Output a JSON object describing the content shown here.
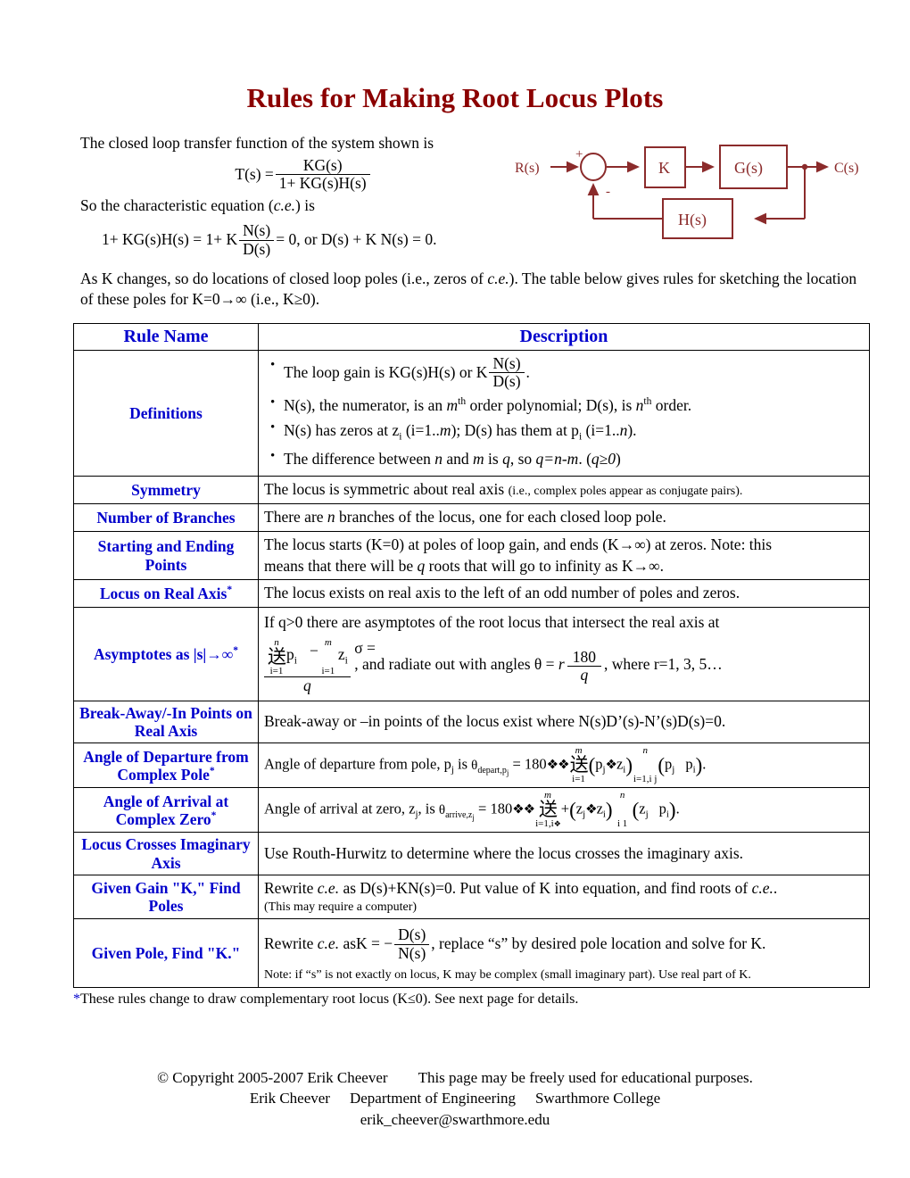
{
  "document": {
    "title": "Rules for Making Root Locus Plots",
    "title_color": "#8B0000",
    "accent_color": "#0000CC"
  },
  "intro": {
    "line1": "The closed loop transfer function of the system shown is",
    "transfer_function": {
      "lhs": "T(s) =",
      "numerator": "KG(s)",
      "denominator": "1+ KG(s)H(s)"
    },
    "line2_a": "So the characteristic equation (",
    "line2_ce": "c.e.",
    "line2_b": ") is",
    "char_eq": {
      "lhs": "1+ KG(s)H(s) = 1+ K",
      "numerator": "N(s)",
      "denominator": "D(s)",
      "mid": "= 0",
      "comma_or": ", or",
      "rhs": "D(s) + K N(s) = 0",
      "period": "."
    },
    "para3_a": "As K changes, so do locations of closed loop poles (i.e., zeros of ",
    "para3_ce": "c.e.",
    "para3_b": ").  The table below gives rules for sketching the location of these poles for K=0→∞ (i.e., K≥0)."
  },
  "diagram": {
    "input_label": "R(s)",
    "output_label": "C(s)",
    "plus_sign": "+",
    "minus_sign": "-",
    "block_k": "K",
    "block_g": "G(s)",
    "block_h": "H(s)",
    "color": "#8B2B2B"
  },
  "table": {
    "headers": {
      "rule_name": "Rule Name",
      "description": "Description"
    },
    "rows": [
      {
        "name": "Definitions",
        "star": false,
        "type": "bullets",
        "bullets": [
          {
            "pre": "The loop gain is KG(s)H(s) or  K",
            "frac_num": "N(s)",
            "frac_den": "D(s)",
            "post": "."
          },
          {
            "text_parts": [
              "N(s), the numerator, is an ",
              "m",
              "th",
              " order polynomial; D(s), is ",
              "n",
              "th",
              " order."
            ]
          },
          {
            "text_parts2": [
              "N(s) has zeros at z",
              "i",
              " (i=1..",
              "m",
              "); D(s) has them at p",
              "i",
              " (i=1..",
              "n",
              ")."
            ]
          },
          {
            "text_parts3": [
              "The difference between ",
              "n",
              " and ",
              "m",
              " is ",
              "q",
              ", so ",
              "q=n-m",
              ".  (",
              "q≥0",
              ")"
            ]
          }
        ]
      },
      {
        "name": "Symmetry",
        "star": false,
        "type": "text_with_small",
        "main": "The locus is symmetric about real axis ",
        "small": "(i.e., complex poles appear as conjugate pairs)."
      },
      {
        "name": "Number of Branches",
        "star": false,
        "type": "italic_n",
        "pre": "There are ",
        "ital": "n",
        "post": " branches of the locus, one for each closed loop pole."
      },
      {
        "name": "Starting and Ending Points",
        "star": false,
        "type": "two_lines_ital",
        "line1": "The locus starts (K=0) at poles of loop gain, and ends (K→∞) at zeros.  Note: this",
        "line2_pre": "means that there will be ",
        "line2_ital": "q",
        "line2_post": " roots that will go to infinity as K→∞."
      },
      {
        "name": "Locus on Real Axis",
        "star": true,
        "type": "plain",
        "text": "The locus exists on real axis to the left of an odd number of poles and zeros."
      },
      {
        "name": "Asymptotes as |s|→∞",
        "star": true,
        "type": "asymptotes",
        "intro": "If q>0 there are asymptotes of the root locus that intersect the real axis at",
        "sigma": "σ =",
        "sum_upper_n": "n",
        "sum_upper_m": "m",
        "sum_lower": "i=1",
        "term_p": "p",
        "term_p_sub": "i",
        "minus": "−",
        "term_z": "z",
        "term_z_sub": "i",
        "denom_q": "q",
        "mid_text": ", and radiate out with angles",
        "theta": "θ =",
        "r_var": "r",
        "angle_num": "180",
        "angle_den": "q",
        "tail": ", where r=1, 3, 5…"
      },
      {
        "name": "Break-Away/-In Points on Real Axis",
        "star": false,
        "type": "plain",
        "text": "Break-away or –in points of the locus exist where N(s)D’(s)-N’(s)D(s)=0."
      },
      {
        "name": "Angle of Departure from Complex Pole",
        "star": true,
        "type": "angle_departure",
        "pre": "Angle of departure from pole, p",
        "pre_sub": "j",
        "pre_end": " is",
        "theta_sym": "θ",
        "theta_sub": "depart,p",
        "theta_sub2": "j",
        "eq_180": "= 180",
        "bad1": "❖❖",
        "sum_upper": "m",
        "sum_lower": "i=1",
        "group1_a": "p",
        "group1_a_sub": "j",
        "group1_bad": "❖",
        "group1_b": "z",
        "group1_b_sub": "i",
        "sum2_upper": "n",
        "sum2_lower": "i=1,i  j",
        "group2_a": "p",
        "group2_a_sub": "j",
        "group2_b": "p",
        "group2_b_sub": "i",
        "period": "."
      },
      {
        "name": "Angle of Arrival at Complex Zero",
        "star": true,
        "type": "angle_arrival",
        "pre": "Angle of arrival at zero, z",
        "pre_sub": "j",
        "pre_end": ", is",
        "theta_sym": "θ",
        "theta_sub": "arrive,z",
        "theta_sub2": "j",
        "eq_180": "= 180",
        "bad1": "❖❖",
        "sum_upper": "m",
        "sum_lower": "i=1,i",
        "sum_lower_bad": "❖",
        "plus": "+",
        "group1_a": "z",
        "group1_a_sub": "j",
        "group1_bad": "❖",
        "group1_b": "z",
        "group1_b_sub": "i",
        "sum2_upper": "n",
        "sum2_lower": "i  1",
        "group2_a": "z",
        "group2_a_sub": "j",
        "group2_b": "p",
        "group2_b_sub": "i",
        "period": "."
      },
      {
        "name": "Locus Crosses Imaginary Axis",
        "star": false,
        "type": "plain",
        "text": "Use Routh-Hurwitz to determine where the locus crosses the imaginary axis."
      },
      {
        "name": "Given Gain \"K,\" Find Poles",
        "star": false,
        "type": "gain_k",
        "main_a": "Rewrite ",
        "main_ce": "c.e.",
        "main_b": " as D(s)+KN(s)=0.  Put value of K into equation, and find roots of ",
        "main_ce2": "c.e.",
        "main_c": ".",
        "small": "(This may require a computer)"
      },
      {
        "name": "Given Pole, Find \"K.\"",
        "star": false,
        "type": "pole_k",
        "main_a": "Rewrite ",
        "main_ce": "c.e.",
        "main_b": " as",
        "k_eq": "K = −",
        "frac_num": "D(s)",
        "frac_den": "N(s)",
        "main_c": ", replace “s” by desired pole location and solve for K.",
        "small": "Note: if “s” is not exactly on locus, K may be complex (small imaginary part).  Use real part of K."
      }
    ]
  },
  "footnote": {
    "star": "*",
    "text": "These rules change to draw complementary root locus (K≤0).  See next page for details."
  },
  "footer": {
    "line1_a": "© Copyright 2005-2007 Erik Cheever",
    "line1_b": "This page may be freely used for educational purposes.",
    "line2_a": "Erik Cheever",
    "line2_b": "Department of Engineering",
    "line2_c": "Swarthmore College",
    "line3": "erik_cheever@swarthmore.edu"
  }
}
